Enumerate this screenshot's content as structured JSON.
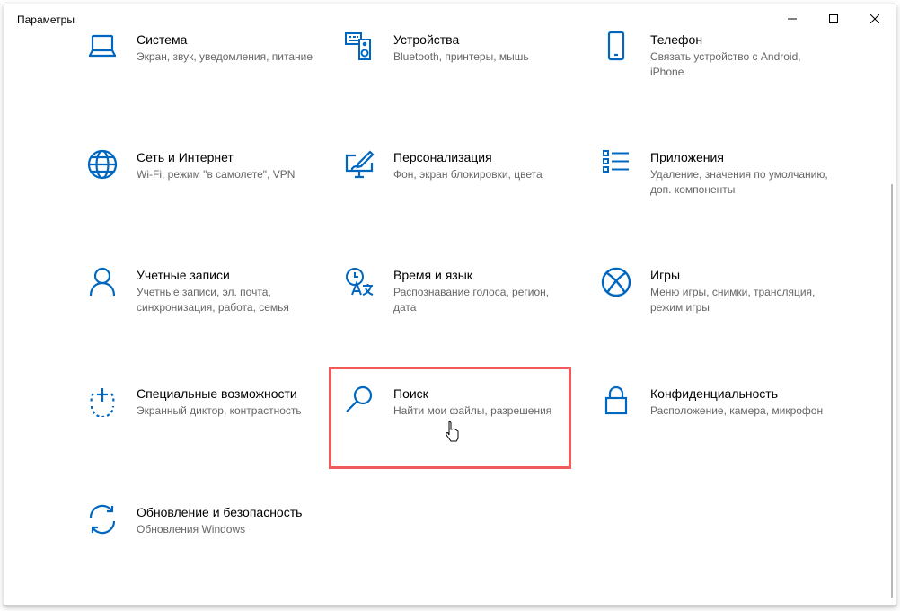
{
  "window": {
    "title": "Параметры",
    "accent": "#0067c0",
    "controls": {
      "minimize": "minimize-icon",
      "maximize": "maximize-icon",
      "close": "close-icon"
    }
  },
  "tiles": [
    {
      "title": "Система",
      "desc": "Экран, звук, уведомления, питание",
      "icon": "laptop-icon"
    },
    {
      "title": "Устройства",
      "desc": "Bluetooth, принтеры, мышь",
      "icon": "keyboard-speaker-icon"
    },
    {
      "title": "Телефон",
      "desc": "Связать устройство с Android, iPhone",
      "icon": "phone-icon"
    },
    {
      "title": "Сеть и Интернет",
      "desc": "Wi-Fi, режим \"в самолете\", VPN",
      "icon": "globe-icon"
    },
    {
      "title": "Персонализация",
      "desc": "Фон, экран блокировки, цвета",
      "icon": "brush-monitor-icon"
    },
    {
      "title": "Приложения",
      "desc": "Удаление, значения по умолчанию, доп. компоненты",
      "icon": "apps-list-icon"
    },
    {
      "title": "Учетные записи",
      "desc": "Учетные записи, эл. почта, синхронизация, работа, семья",
      "icon": "person-icon"
    },
    {
      "title": "Время и язык",
      "desc": "Распознавание голоса, регион, дата",
      "icon": "time-language-icon"
    },
    {
      "title": "Игры",
      "desc": "Меню игры, снимки, трансляция, режим игры",
      "icon": "xbox-icon"
    },
    {
      "title": "Специальные возможности",
      "desc": "Экранный диктор, контрастность",
      "icon": "ease-of-access-icon"
    },
    {
      "title": "Поиск",
      "desc": "Найти мои файлы, разрешения",
      "icon": "search-icon"
    },
    {
      "title": "Конфиденциальность",
      "desc": "Расположение, камера, микрофон",
      "icon": "lock-icon"
    },
    {
      "title": "Обновление и безопасность",
      "desc": "Обновления Windows",
      "icon": "sync-icon"
    }
  ],
  "highlight_color": "#ef5b5b"
}
